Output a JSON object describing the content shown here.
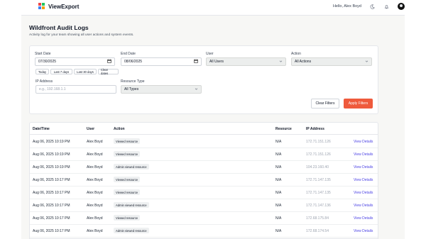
{
  "header": {
    "brand": "ViewExport",
    "greeting": "Hello, Alex Boyd"
  },
  "page": {
    "title": "Wildfront Audit Logs",
    "subtitle": "Activity log for your team showing all user actions and system events."
  },
  "filters": {
    "start_date_label": "Start Date",
    "start_date_value": "07/30/2025",
    "end_date_label": "End Date",
    "end_date_value": "08/06/2025",
    "user_label": "User",
    "user_value": "All Users",
    "action_label": "Action",
    "action_value": "All Actions",
    "quick_ranges": [
      "Today",
      "Last 7 days",
      "Last 30 days",
      "Clear dates"
    ],
    "ip_label": "IP Address",
    "ip_placeholder": "e.g., 192.168.1.1",
    "resource_type_label": "Resource Type",
    "resource_type_value": "All Types",
    "clear_button": "Clear Filters",
    "apply_button": "Apply Filters"
  },
  "table": {
    "columns": [
      "Date/Time",
      "User",
      "Action",
      "Resource",
      "IP Address"
    ],
    "link_label": "View Details",
    "rows": [
      {
        "datetime": "Aug 06, 2025 10:19 PM",
        "user": "Alex Boyd",
        "action": "Viewed resource",
        "resource": "N/A",
        "ip": "172.71.151.126"
      },
      {
        "datetime": "Aug 06, 2025 10:19 PM",
        "user": "Alex Boyd",
        "action": "Viewed resource",
        "resource": "N/A",
        "ip": "172.71.151.126"
      },
      {
        "datetime": "Aug 06, 2025 10:19 PM",
        "user": "Alex Boyd",
        "action": "Admin viewed resource",
        "resource": "N/A",
        "ip": "104.23.160.40"
      },
      {
        "datetime": "Aug 06, 2025 10:17 PM",
        "user": "Alex Boyd",
        "action": "Viewed resource",
        "resource": "N/A",
        "ip": "172.71.147.135"
      },
      {
        "datetime": "Aug 06, 2025 10:17 PM",
        "user": "Alex Boyd",
        "action": "Viewed resource",
        "resource": "N/A",
        "ip": "172.71.147.135"
      },
      {
        "datetime": "Aug 06, 2025 10:17 PM",
        "user": "Alex Boyd",
        "action": "Admin viewed resource",
        "resource": "N/A",
        "ip": "172.71.147.136"
      },
      {
        "datetime": "Aug 06, 2025 10:17 PM",
        "user": "Alex Boyd",
        "action": "Viewed resource",
        "resource": "N/A",
        "ip": "172.68.175.84"
      },
      {
        "datetime": "Aug 06, 2025 10:17 PM",
        "user": "Alex Boyd",
        "action": "Admin viewed resource",
        "resource": "N/A",
        "ip": "172.68.174.54"
      }
    ]
  },
  "colors": {
    "accent": "#ef5a3c",
    "link": "#4f46e5",
    "logo": [
      "#ef4444",
      "#22c55e",
      "#3b82f6",
      "#f59e0b"
    ]
  },
  "icons": {
    "theme_toggle": "moon-icon",
    "notifications": "bell-icon",
    "calendar": "calendar-icon",
    "dropdown": "chevron-down-icon"
  }
}
